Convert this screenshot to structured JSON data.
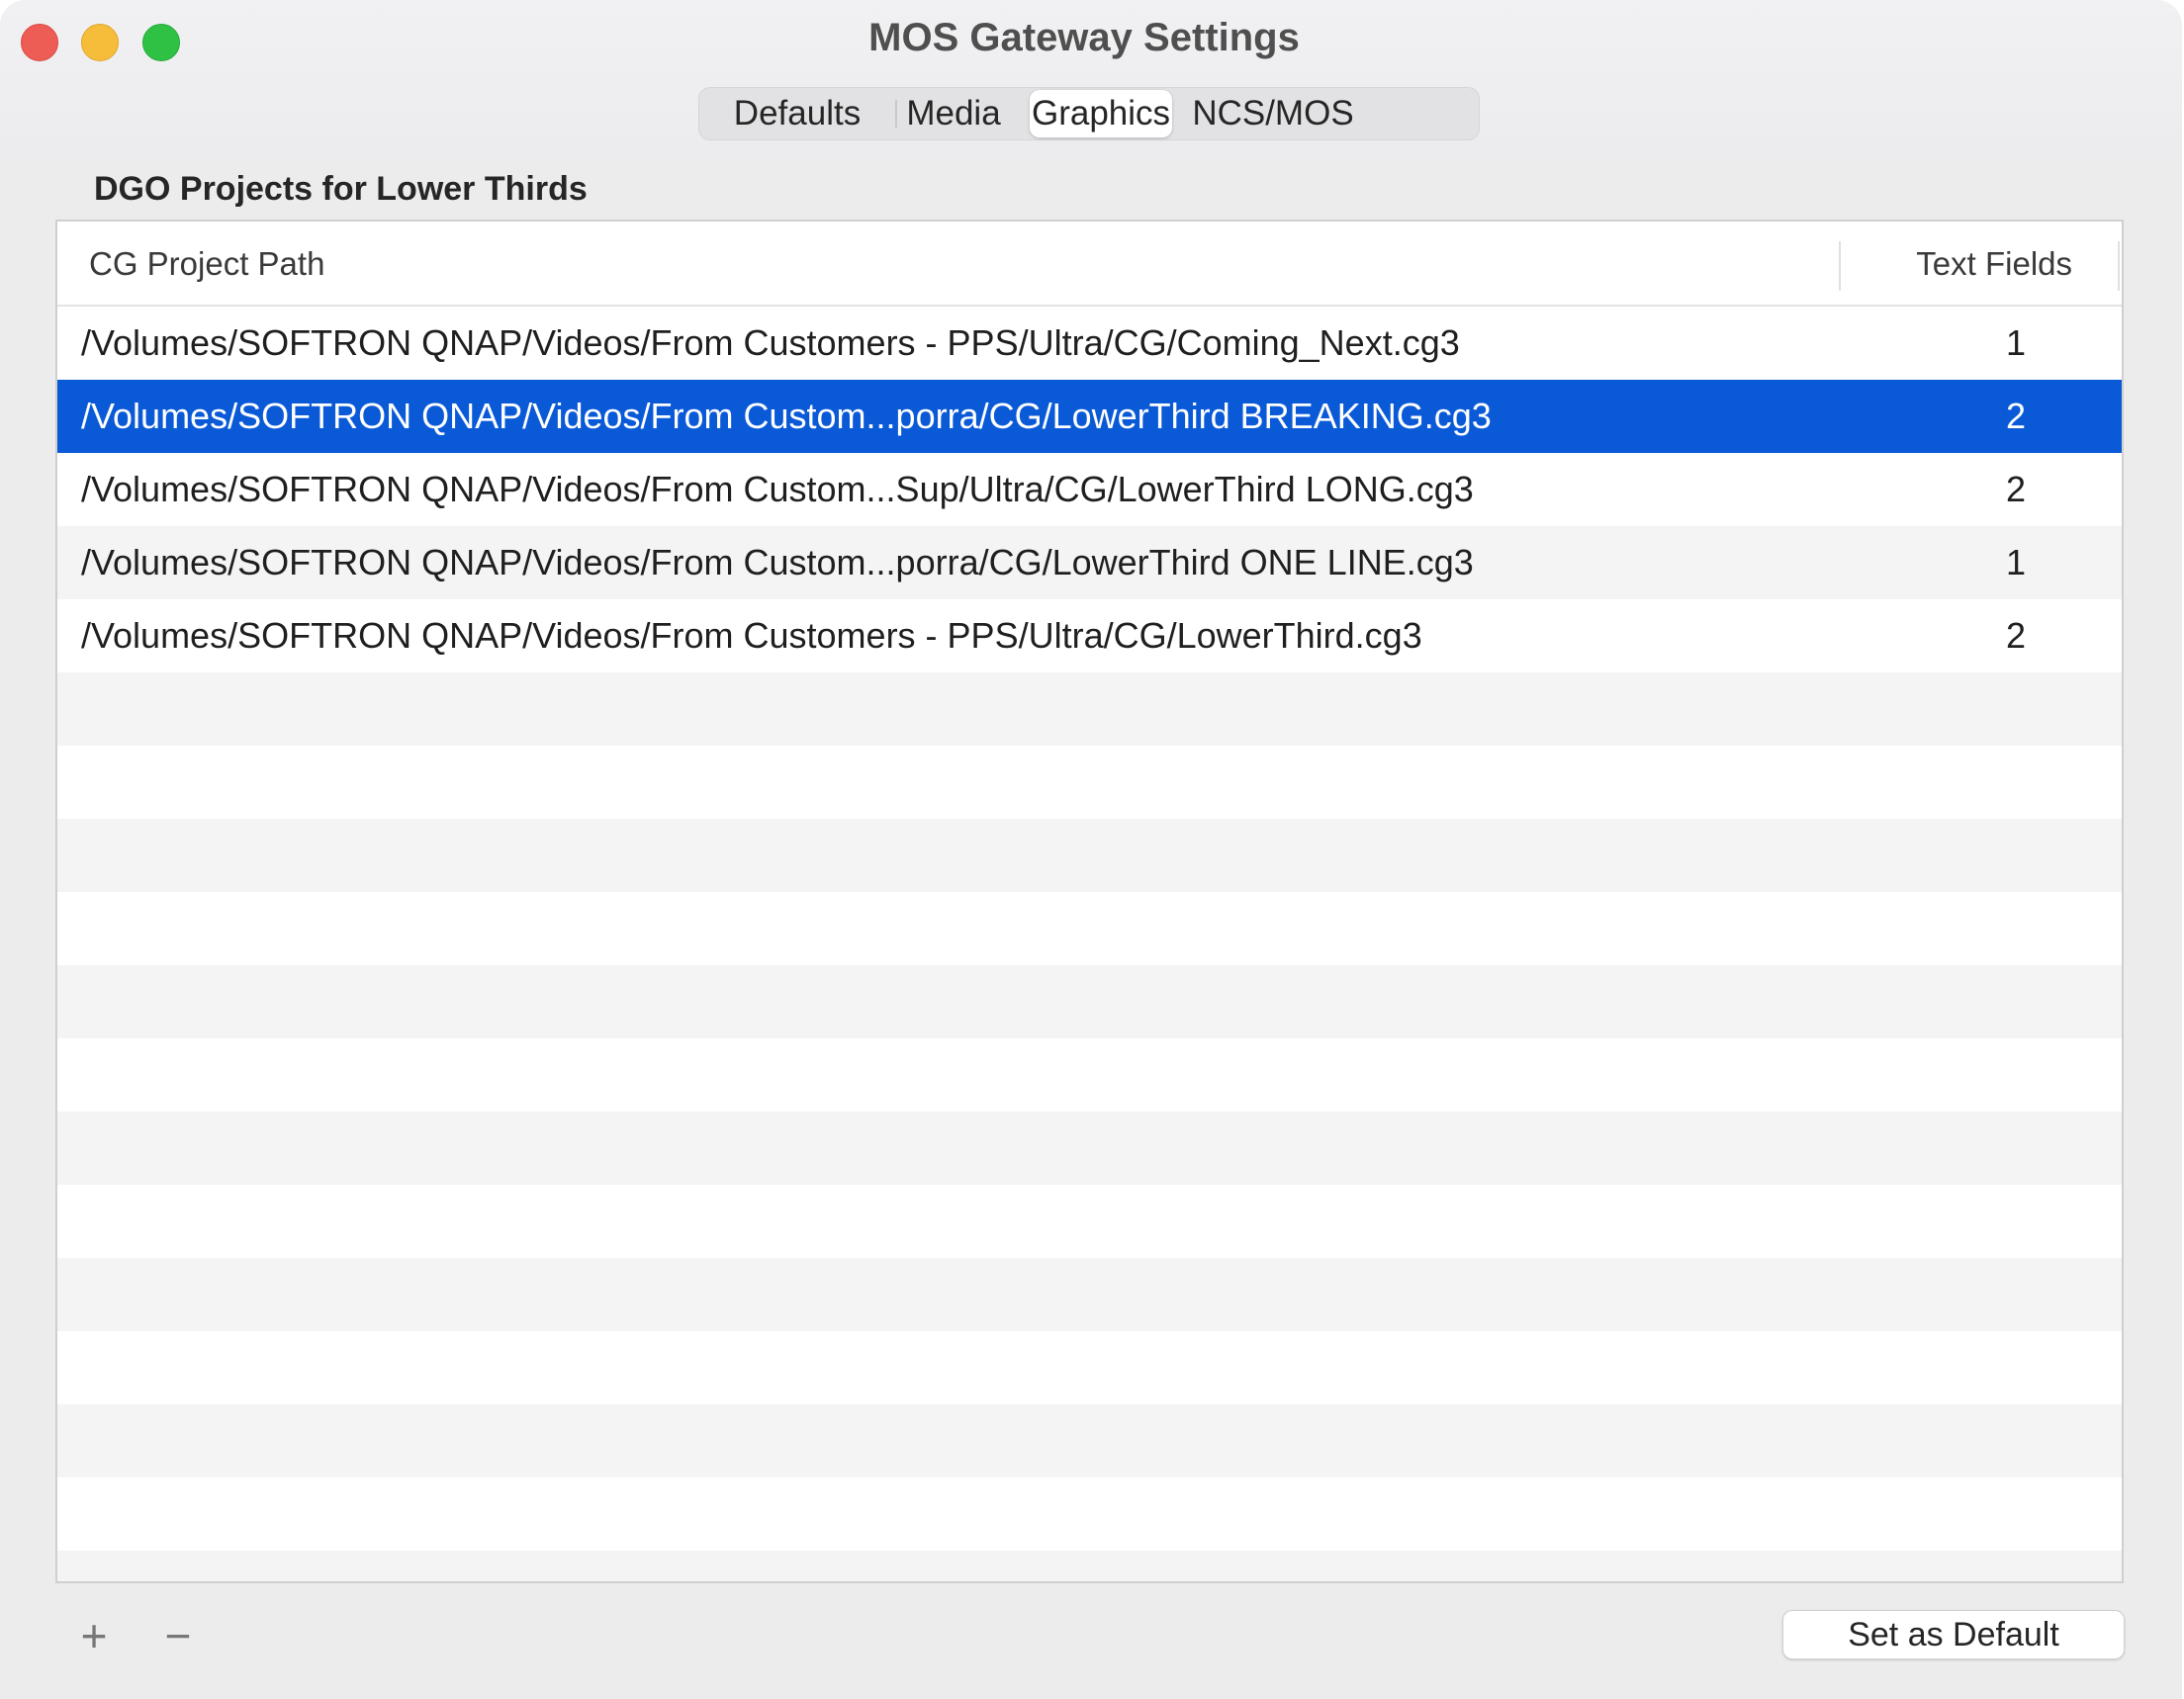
{
  "window": {
    "title": "MOS Gateway Settings"
  },
  "tabs": [
    {
      "label": "Defaults",
      "active": false
    },
    {
      "label": "Media",
      "active": false
    },
    {
      "label": "Graphics",
      "active": true
    },
    {
      "label": "NCS/MOS",
      "active": false
    }
  ],
  "section": {
    "title": "DGO Projects for Lower Thirds"
  },
  "table": {
    "columns": {
      "path": "CG Project Path",
      "fields": "Text Fields"
    },
    "rows": [
      {
        "path": "/Volumes/SOFTRON QNAP/Videos/From Customers - PPS/Ultra/CG/Coming_Next.cg3",
        "fields": "1",
        "selected": false
      },
      {
        "path": "/Volumes/SOFTRON QNAP/Videos/From Custom...porra/CG/LowerThird BREAKING.cg3",
        "fields": "2",
        "selected": true
      },
      {
        "path": "/Volumes/SOFTRON QNAP/Videos/From Custom...Sup/Ultra/CG/LowerThird LONG.cg3",
        "fields": "2",
        "selected": false
      },
      {
        "path": "/Volumes/SOFTRON QNAP/Videos/From Custom...porra/CG/LowerThird ONE LINE.cg3",
        "fields": "1",
        "selected": false
      },
      {
        "path": "/Volumes/SOFTRON QNAP/Videos/From Customers - PPS/Ultra/CG/LowerThird.cg3",
        "fields": "2",
        "selected": false
      }
    ]
  },
  "footer": {
    "add_label": "+",
    "remove_label": "−",
    "default_label": "Set as Default"
  },
  "colors": {
    "selection": "#0a5ad8",
    "close": "#ee5d55",
    "minimize": "#f6bd3b",
    "maximize": "#2fc144"
  }
}
